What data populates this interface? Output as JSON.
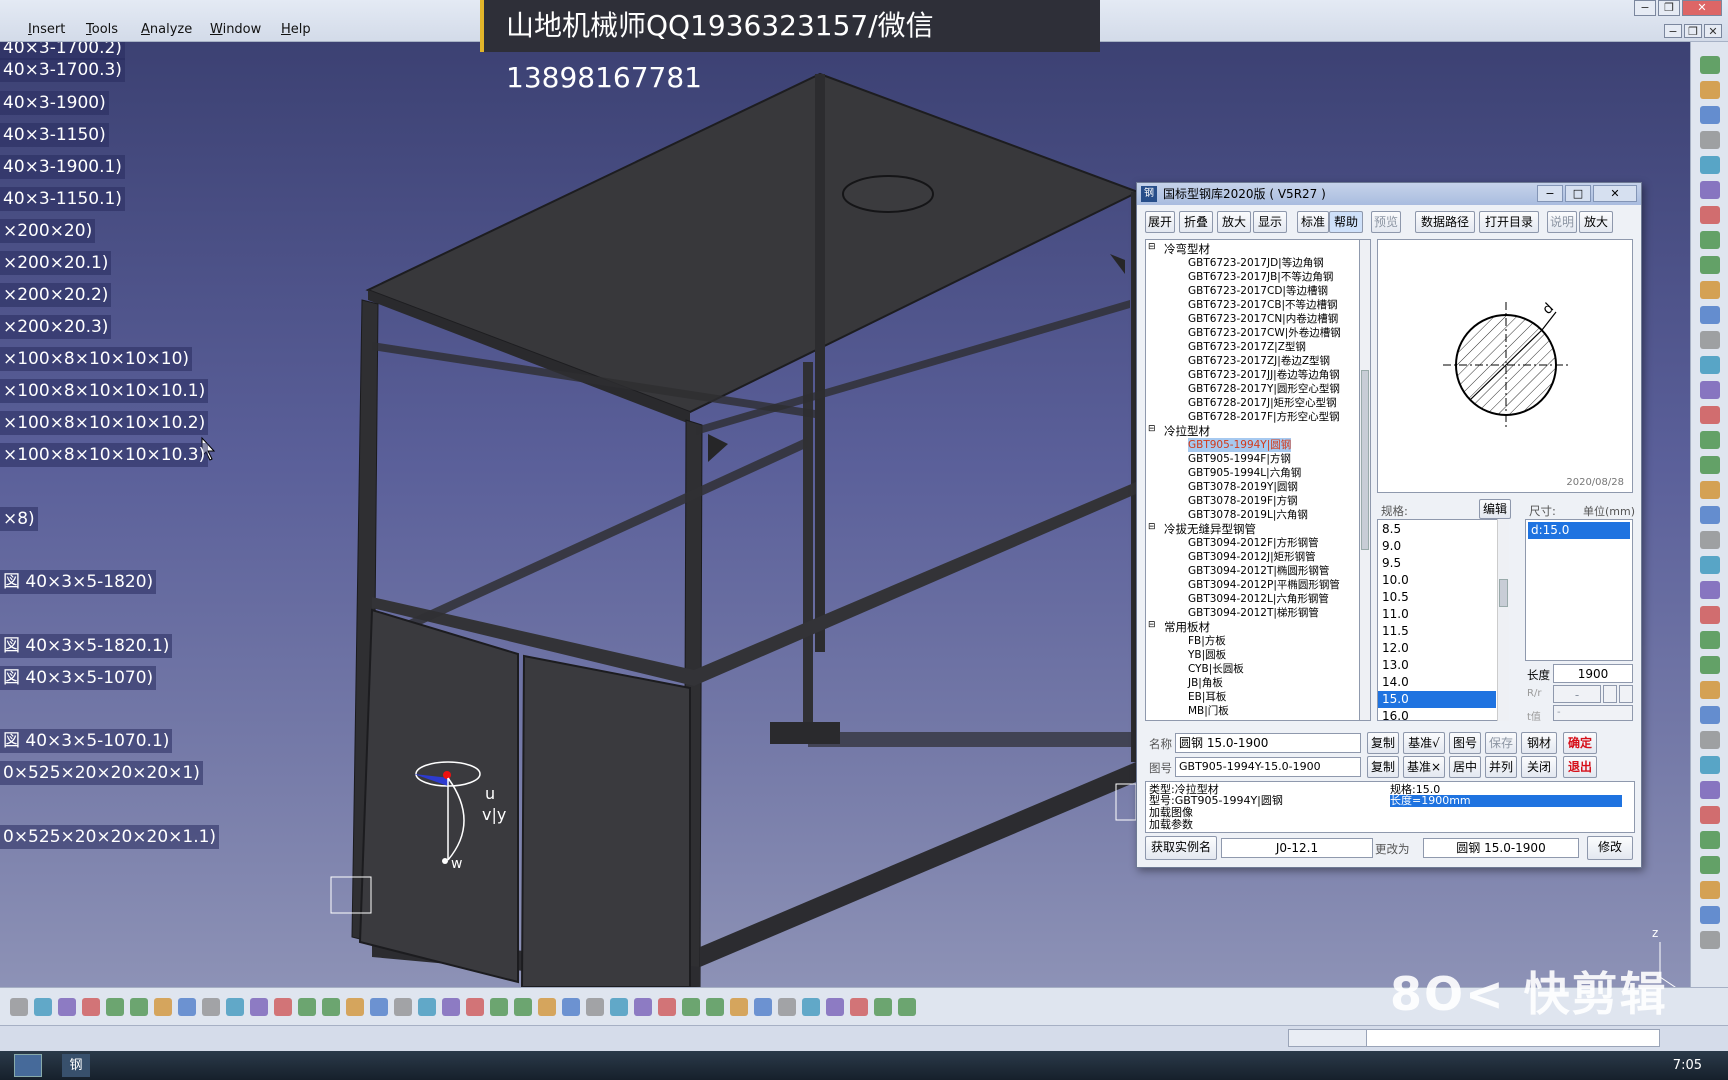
{
  "menu": [
    "Insert",
    "Tools",
    "Analyze",
    "Window",
    "Help"
  ],
  "banner": "山地机械师QQ1936323157/微信13898167781",
  "tree_labels": [
    "40×3-1700.2)",
    "40×3-1700.3)",
    "40×3-1900)",
    "40×3-1150)",
    "40×3-1900.1)",
    "40×3-1150.1)",
    "×200×20)",
    "×200×20.1)",
    "×200×20.2)",
    "×200×20.3)",
    "×100×8×10×10×10)",
    "×100×8×10×10×10.1)",
    "×100×8×10×10×10.2)",
    "×100×8×10×10×10.3)",
    "×8)",
    "図 40×3×5-1820)",
    "図 40×3×5-1820.1)",
    "図 40×3×5-1070)",
    "図 40×3×5-1070.1)",
    "0×525×20×20×20×1)",
    "0×525×20×20×20×1.1)"
  ],
  "compass": {
    "u": "u",
    "v": "v|y",
    "w": "w"
  },
  "watermark": "8O< 快剪辑",
  "clock": "7:05",
  "dialog": {
    "title": "国标型钢库2020版 ( V5R27 )",
    "logo": "钢",
    "toolbar": [
      "展开",
      "折叠",
      "放大",
      "显示",
      "标准",
      "帮助",
      "预览",
      "数据路径",
      "打开目录",
      "说明",
      "放大"
    ],
    "tree": [
      {
        "label": "冷弯型材",
        "cat": true
      },
      {
        "label": "GBT6723-2017JD|等边角钢"
      },
      {
        "label": "GBT6723-2017JB|不等边角钢"
      },
      {
        "label": "GBT6723-2017CD|等边槽钢"
      },
      {
        "label": "GBT6723-2017CB|不等边槽钢"
      },
      {
        "label": "GBT6723-2017CN|内卷边槽钢"
      },
      {
        "label": "GBT6723-2017CW|外卷边槽钢"
      },
      {
        "label": "GBT6723-2017Z|Z型钢"
      },
      {
        "label": "GBT6723-2017ZJ|卷边Z型钢"
      },
      {
        "label": "GBT6723-2017JJ|卷边等边角钢"
      },
      {
        "label": "GBT6728-2017Y|圆形空心型钢"
      },
      {
        "label": "GBT6728-2017J|矩形空心型钢"
      },
      {
        "label": "GBT6728-2017F|方形空心型钢"
      },
      {
        "label": "冷拉型材",
        "cat": true
      },
      {
        "label": "GBT905-1994Y|圆钢",
        "selected": true
      },
      {
        "label": "GBT905-1994F|方钢"
      },
      {
        "label": "GBT905-1994L|六角钢"
      },
      {
        "label": "GBT3078-2019Y|圆钢"
      },
      {
        "label": "GBT3078-2019F|方钢"
      },
      {
        "label": "GBT3078-2019L|六角钢"
      },
      {
        "label": "冷拔无缝异型钢管",
        "cat": true
      },
      {
        "label": "GBT3094-2012F|方形钢管"
      },
      {
        "label": "GBT3094-2012J|矩形钢管"
      },
      {
        "label": "GBT3094-2012T|椭圆形钢管"
      },
      {
        "label": "GBT3094-2012P|平椭圆形钢管"
      },
      {
        "label": "GBT3094-2012L|六角形钢管"
      },
      {
        "label": "GBT3094-2012T|梯形钢管"
      },
      {
        "label": "常用板材",
        "cat": true
      },
      {
        "label": "FB|方板"
      },
      {
        "label": "YB|圆板"
      },
      {
        "label": "CYB|长圆板"
      },
      {
        "label": "JB|角板"
      },
      {
        "label": "EB|耳板"
      },
      {
        "label": "MB|门板"
      }
    ],
    "preview_label": "d",
    "preview_date": "2020/08/28",
    "spec_label": "规格:",
    "edit_btn": "编辑",
    "dim_label": "尺寸:",
    "unit_label": "单位(mm)",
    "specs": [
      "8.5",
      "9.0",
      "9.5",
      "10.0",
      "10.5",
      "11.0",
      "11.5",
      "12.0",
      "13.0",
      "14.0",
      "15.0",
      "16.0"
    ],
    "selected_spec": "15.0",
    "dim_selected": "d:15.0",
    "length_label": "长度",
    "length_value": "1900",
    "rr_label": "R/r",
    "rr_value": "-",
    "t_label": "t值",
    "t_value": "-",
    "name_label": "名称",
    "name_value": "圆钢 15.0-1900",
    "figno_label": "图号",
    "figno_value": "GBT905-1994Y-15.0-1900",
    "row1_btns": [
      "复制",
      "基准√",
      "图号",
      "保存",
      "钢材",
      "确定"
    ],
    "row2_btns": [
      "复制",
      "基准×",
      "居中",
      "并列",
      "关闭",
      "退出"
    ],
    "info": {
      "type": "类型:冷拉型材",
      "model": "型号:GBT905-1994Y|圆钢",
      "load_img": "加载图像",
      "load_param": "加载参数",
      "spec": "规格:15.0",
      "length": "长度=1900mm"
    },
    "bottom": {
      "get_btn": "获取实例名",
      "instance": "J0-12.1",
      "change_label": "更改为",
      "target": "圆钢 15.0-1900",
      "modify_btn": "修改"
    }
  }
}
